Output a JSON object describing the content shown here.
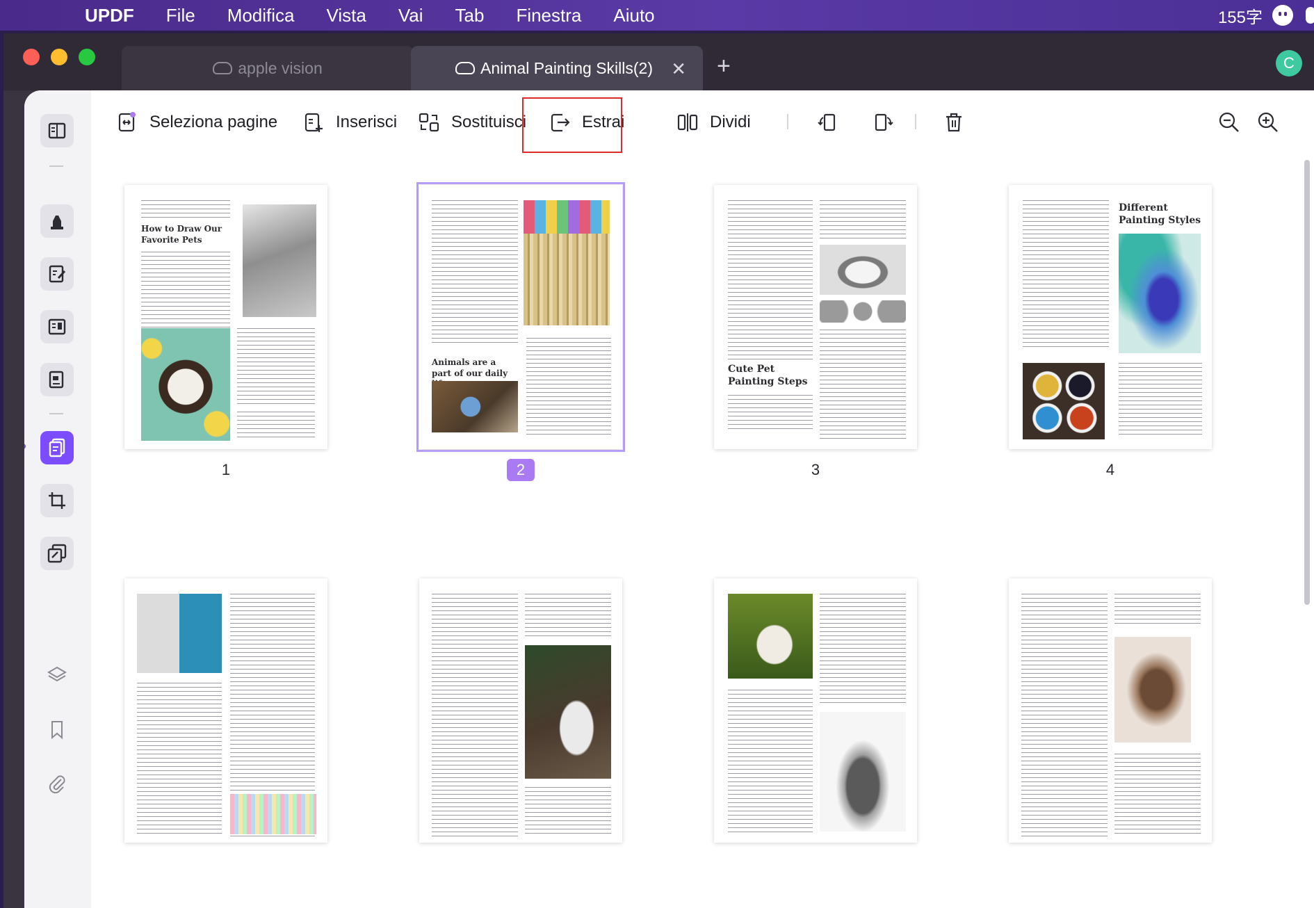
{
  "menubar": {
    "app": "UPDF",
    "items": [
      "File",
      "Modifica",
      "Vista",
      "Vai",
      "Tab",
      "Finestra",
      "Aiuto"
    ],
    "char_count": "155字"
  },
  "tabs": [
    {
      "label": "apple vision",
      "active": false
    },
    {
      "label": "Animal Painting Skills(2)",
      "active": true
    }
  ],
  "user_avatar": "C",
  "toolbar": {
    "select_pages": "Seleziona pagine",
    "insert": "Inserisci",
    "replace": "Sostituisci",
    "extract": "Estrai",
    "split": "Dividi"
  },
  "pages": [
    {
      "number": "1",
      "selected": false,
      "headings": [
        "How to Draw Our Favorite Pets"
      ]
    },
    {
      "number": "2",
      "selected": true,
      "headings": [
        "Animals are a part of our daily life"
      ]
    },
    {
      "number": "3",
      "selected": false,
      "headings": [
        "Cute Pet Painting Steps"
      ]
    },
    {
      "number": "4",
      "selected": false,
      "headings": [
        "Different Painting Styles"
      ]
    },
    {
      "number": "",
      "selected": false,
      "headings": []
    },
    {
      "number": "",
      "selected": false,
      "headings": []
    },
    {
      "number": "",
      "selected": false,
      "headings": []
    },
    {
      "number": "",
      "selected": false,
      "headings": []
    }
  ],
  "colors": {
    "accent": "#7c4dff",
    "highlight_box": "#e02a2a",
    "selected_outline": "#b59cf6"
  }
}
